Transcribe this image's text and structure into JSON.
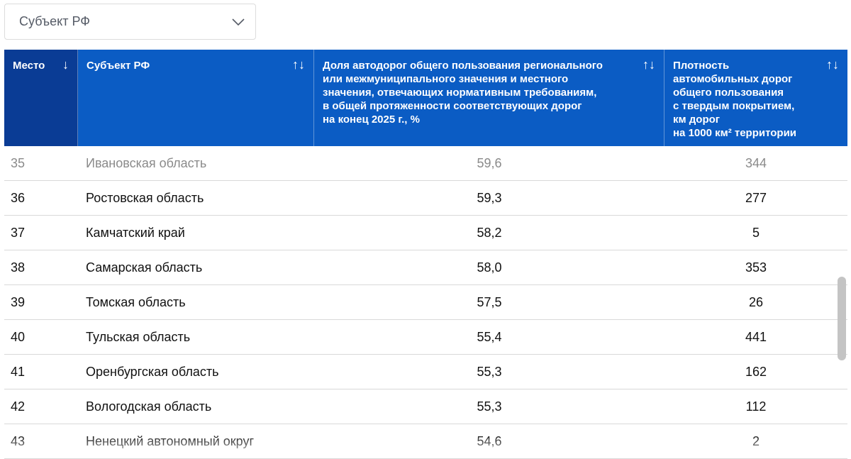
{
  "filter": {
    "label": "Субъект РФ",
    "icon": "chevron-down-icon"
  },
  "header": {
    "place": "Место",
    "place_sort": "↓",
    "subject": "Субъект РФ",
    "subject_sort": "↑↓",
    "share": "Доля автодорог общего пользования регионального\nили межмуниципального значения и местного\nзначения, отвечающих нормативным требованиям,\nв общей протяженности соответствующих дорог\nна конец 2025 г., %",
    "share_sort": "↑↓",
    "density": "Плотность\nавтомобильных дорог\nобщего пользования\nс твердым покрытием,\nкм дорог\nна 1000 км² территории",
    "density_sort": "↑↓"
  },
  "colors": {
    "header_bg": "#0b5cc4",
    "header_active_bg": "#0a3c95"
  },
  "rows": [
    {
      "place": "35",
      "subject": "Ивановская область",
      "share": "59,6",
      "density": "344"
    },
    {
      "place": "36",
      "subject": "Ростовская область",
      "share": "59,3",
      "density": "277"
    },
    {
      "place": "37",
      "subject": "Камчатский край",
      "share": "58,2",
      "density": "5"
    },
    {
      "place": "38",
      "subject": "Самарская область",
      "share": "58,0",
      "density": "353"
    },
    {
      "place": "39",
      "subject": "Томская область",
      "share": "57,5",
      "density": "26"
    },
    {
      "place": "40",
      "subject": "Тульская область",
      "share": "55,4",
      "density": "441"
    },
    {
      "place": "41",
      "subject": "Оренбургская область",
      "share": "55,3",
      "density": "162"
    },
    {
      "place": "42",
      "subject": "Вологодская область",
      "share": "55,3",
      "density": "112"
    },
    {
      "place": "43",
      "subject": "Ненецкий автономный округ",
      "share": "54,6",
      "density": "2"
    }
  ]
}
